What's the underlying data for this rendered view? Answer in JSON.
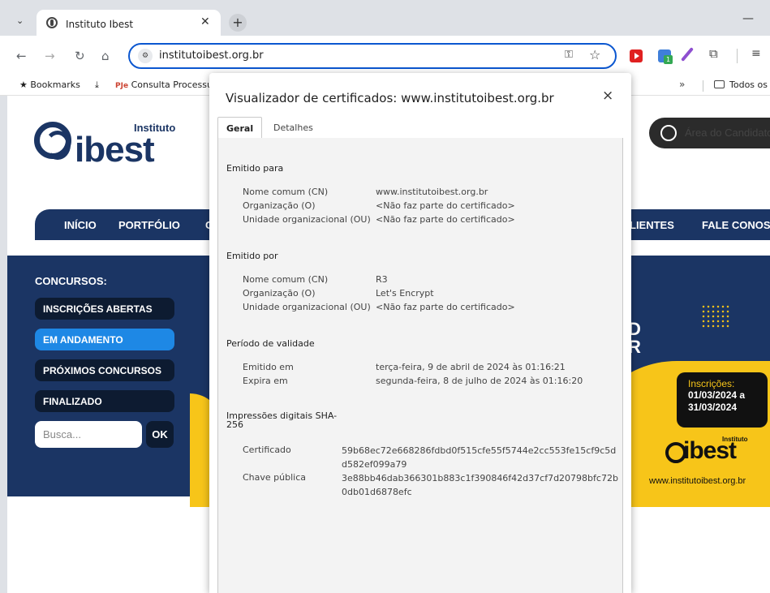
{
  "browser": {
    "tab_title": "Instituto Ibest",
    "url": "institutoibest.org.br",
    "bookmarks": [
      {
        "label": "Bookmarks"
      },
      {
        "label": "Consulta Processu"
      },
      {
        "label": "Todos os"
      }
    ],
    "bookmarks_more": "»"
  },
  "site": {
    "logo_small": "Instituto",
    "logo_big": "ibest",
    "candidate_button": "Área do Candidato",
    "nav": [
      "INÍCIO",
      "PORTFÓLIO",
      "C",
      "LIENTES",
      "FALE CONOS"
    ],
    "concursos_heading": "CONCURSOS:",
    "menu": [
      "INSCRIÇÕES ABERTAS",
      "EM ANDAMENTO",
      "PRÓXIMOS CONCURSOS",
      "FINALIZADO"
    ],
    "search_placeholder": "Busca...",
    "search_button": "OK",
    "banner": {
      "partial_text": "D\nR",
      "inscricoes_title": "Inscrições:",
      "inscricoes_dates": "01/03/2024 a\n31/03/2024",
      "logo_small": "Instituto",
      "logo_big": "ibest",
      "site": "www.institutoibest.org.br"
    }
  },
  "dialog": {
    "title": "Visualizador de certificados: www.institutoibest.org.br",
    "close": "×",
    "tabs": [
      "Geral",
      "Detalhes"
    ],
    "issued_to": {
      "heading": "Emitido para",
      "rows": [
        {
          "label": "Nome comum (CN)",
          "value": "www.institutoibest.org.br"
        },
        {
          "label": "Organização (O)",
          "value": "<Não faz parte do certificado>"
        },
        {
          "label": "Unidade organizacional (OU)",
          "value": "<Não faz parte do certificado>"
        }
      ]
    },
    "issued_by": {
      "heading": "Emitido por",
      "rows": [
        {
          "label": "Nome comum (CN)",
          "value": "R3"
        },
        {
          "label": "Organização (O)",
          "value": "Let's Encrypt"
        },
        {
          "label": "Unidade organizacional (OU)",
          "value": "<Não faz parte do certificado>"
        }
      ]
    },
    "validity": {
      "heading": "Período de validade",
      "rows": [
        {
          "label": "Emitido em",
          "value": "terça-feira, 9 de abril de 2024 às 01:16:21"
        },
        {
          "label": "Expira em",
          "value": "segunda-feira, 8 de julho de 2024 às 01:16:20"
        }
      ]
    },
    "fingerprints": {
      "heading": "Impressões digitais SHA-256",
      "rows": [
        {
          "label": "Certificado",
          "value": "59b68ec72e668286fdbd0f515cfe55f5744e2cc553fe15cf9c5dd582ef099a79"
        },
        {
          "label": "Chave pública",
          "value": "3e88bb46dab366301b883c1f390846f42d37cf7d20798bfc72b0db01d6878efc"
        }
      ]
    }
  }
}
